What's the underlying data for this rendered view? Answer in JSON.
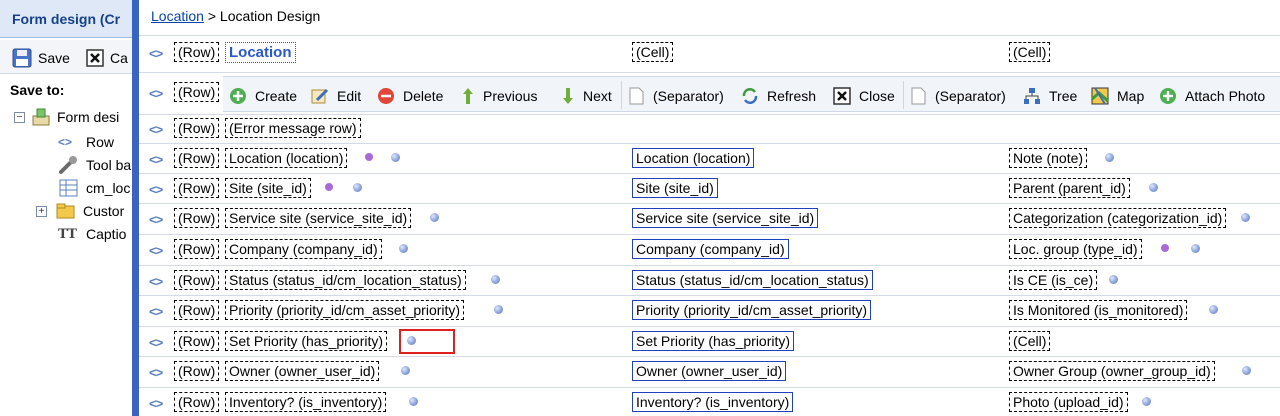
{
  "left_panel": {
    "title": "Form design (Cr",
    "toolbar": {
      "save_label": "Save",
      "cancel_label": "Ca"
    },
    "save_to_label": "Save to:",
    "tree": {
      "root_label": "Form desi",
      "children": [
        {
          "label": "Row",
          "icon": "row-arrows-icon"
        },
        {
          "label": "Tool ba",
          "icon": "wrench-icon"
        },
        {
          "label": "cm_loc",
          "icon": "table-icon"
        },
        {
          "label": "Custor",
          "icon": "custom-folder-icon"
        },
        {
          "label": "Captio",
          "icon": "caption-tt-icon"
        }
      ]
    }
  },
  "breadcrumb": {
    "link": "Location",
    "separator": ">",
    "current": "Location Design"
  },
  "row_label": "(Row)",
  "title_row": {
    "col1": "Location",
    "col2": "(Cell)",
    "col3": "(Cell)"
  },
  "toolbar": {
    "create": "Create",
    "edit": "Edit",
    "delete": "Delete",
    "previous": "Previous",
    "next": "Next",
    "separator1": "(Separator)",
    "refresh": "Refresh",
    "close": "Close",
    "separator2": "(Separator)",
    "tree": "Tree",
    "map": "Map",
    "attach_photo": "Attach Photo"
  },
  "error_row": {
    "label": "(Error message row)"
  },
  "rows": [
    {
      "col1": "Location (location)",
      "col2": "Location (location)",
      "col3": "Note (note)"
    },
    {
      "col1": "Site (site_id)",
      "col2": "Site (site_id)",
      "col3": "Parent (parent_id)"
    },
    {
      "col1": "Service site (service_site_id)",
      "col2": "Service site (service_site_id)",
      "col3": "Categorization (categorization_id)"
    },
    {
      "col1": "Company (company_id)",
      "col2": "Company (company_id)",
      "col3": "Loc. group (type_id)"
    },
    {
      "col1": "Status (status_id/cm_location_status)",
      "col2": "Status (status_id/cm_location_status)",
      "col3": "Is CE (is_ce)"
    },
    {
      "col1": "Priority (priority_id/cm_asset_priority)",
      "col2": "Priority (priority_id/cm_asset_priority)",
      "col3": "Is Monitored (is_monitored)"
    },
    {
      "col1": "Set Priority (has_priority)",
      "col2": "Set Priority (has_priority)",
      "col3": "(Cell)"
    },
    {
      "col1": "Owner (owner_user_id)",
      "col2": "Owner (owner_user_id)",
      "col3": "Owner Group (owner_group_id)"
    },
    {
      "col1": "Inventory? (is_inventory)",
      "col2": "Inventory? (is_inventory)",
      "col3": "Photo (upload_id)"
    }
  ],
  "colors": {
    "accent": "#3a64c2",
    "title_text": "#2a57c8",
    "highlight": "#e02020",
    "required_dot": "#a96ad8"
  }
}
